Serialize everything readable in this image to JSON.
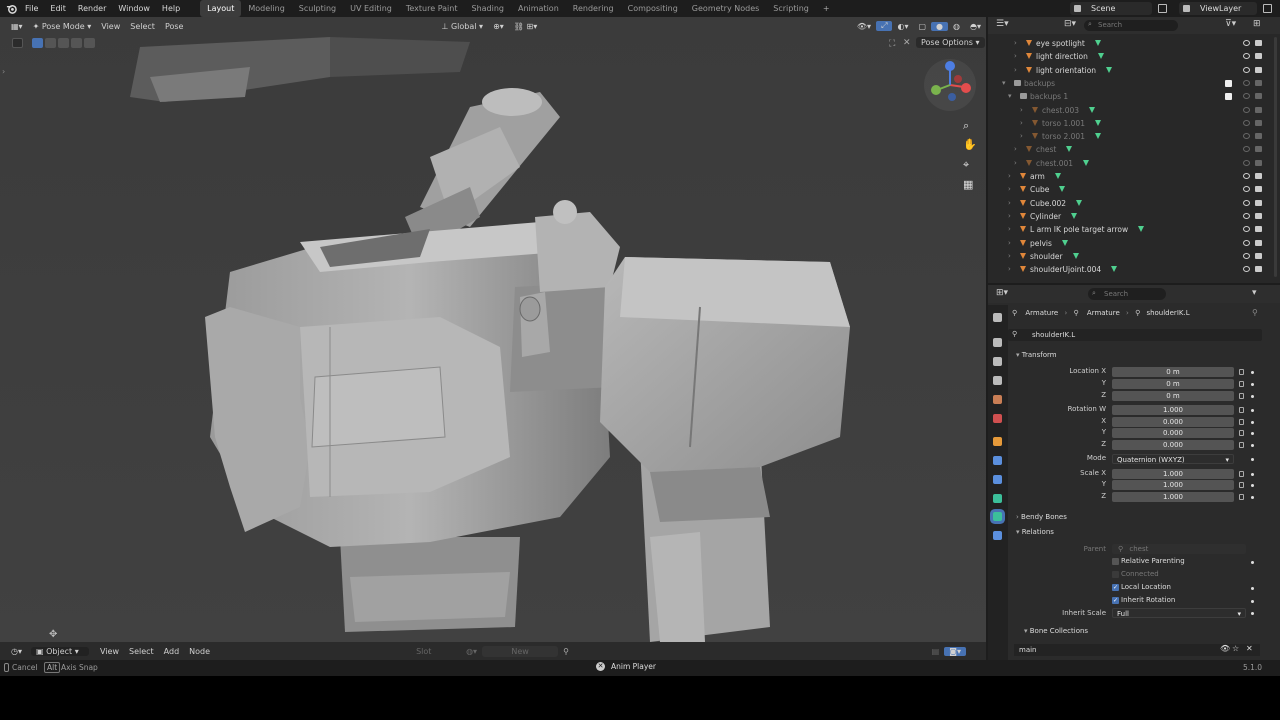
{
  "menu": [
    "File",
    "Edit",
    "Render",
    "Window",
    "Help"
  ],
  "workspaces": [
    "Layout",
    "Modeling",
    "Sculpting",
    "UV Editing",
    "Texture Paint",
    "Shading",
    "Animation",
    "Rendering",
    "Compositing",
    "Geometry Nodes",
    "Scripting"
  ],
  "active_workspace": "Layout",
  "scene": "Scene",
  "view_layer": "ViewLayer",
  "viewport": {
    "mode": "Pose Mode",
    "menus": [
      "View",
      "Select",
      "Pose"
    ],
    "transform_orientation": "Global",
    "pose_options": "Pose Options"
  },
  "outliner": {
    "search_placeholder": "Search",
    "rows": [
      {
        "label": "eye spotlight",
        "dim": false,
        "indent": 3
      },
      {
        "label": "light direction",
        "dim": false,
        "indent": 3
      },
      {
        "label": "light orientation",
        "dim": false,
        "indent": 3
      },
      {
        "label": "backups",
        "dim": true,
        "indent": 1
      },
      {
        "label": "backups 1",
        "dim": true,
        "indent": 2
      },
      {
        "label": "chest.003",
        "dim": true,
        "indent": 4
      },
      {
        "label": "torso 1.001",
        "dim": true,
        "indent": 4
      },
      {
        "label": "torso 2.001",
        "dim": true,
        "indent": 4
      },
      {
        "label": "chest",
        "dim": true,
        "indent": 3
      },
      {
        "label": "chest.001",
        "dim": true,
        "indent": 3
      },
      {
        "label": "arm",
        "dim": false,
        "indent": 2
      },
      {
        "label": "Cube",
        "dim": false,
        "indent": 2
      },
      {
        "label": "Cube.002",
        "dim": false,
        "indent": 2
      },
      {
        "label": "Cylinder",
        "dim": false,
        "indent": 2
      },
      {
        "label": "L arm IK pole target arrow",
        "dim": false,
        "indent": 2
      },
      {
        "label": "pelvis",
        "dim": false,
        "indent": 2
      },
      {
        "label": "shoulder",
        "dim": false,
        "indent": 2
      },
      {
        "label": "shoulderUjoint.004",
        "dim": false,
        "indent": 2
      }
    ]
  },
  "properties": {
    "search_placeholder": "Search",
    "breadcrumb": [
      "Armature",
      "Armature",
      "shoulderIK.L"
    ],
    "bone_name": "shoulderIK.L",
    "transform": {
      "title": "Transform",
      "location_label": "Location X",
      "location": [
        "0 m",
        "0 m",
        "0 m"
      ],
      "rotation_label": "Rotation W",
      "rotation": [
        "1.000",
        "0.000",
        "0.000",
        "0.000"
      ],
      "mode_label": "Mode",
      "mode": "Quaternion (WXYZ)",
      "scale_label": "Scale X",
      "scale": [
        "1.000",
        "1.000",
        "1.000"
      ],
      "axis_y": "Y",
      "axis_z": "Z",
      "axis_x": "X"
    },
    "bendy_bones": "Bendy Bones",
    "relations": {
      "title": "Relations",
      "parent_label": "Parent",
      "parent": "chest",
      "relative_parenting": "Relative Parenting",
      "connected": "Connected",
      "local_location": "Local Location",
      "inherit_rotation": "Inherit Rotation",
      "inherit_scale_label": "Inherit Scale",
      "inherit_scale": "Full"
    },
    "bone_collections": {
      "title": "Bone Collections",
      "item": "main"
    }
  },
  "bottom_editor": {
    "mode": "Object",
    "menus": [
      "View",
      "Select",
      "Add",
      "Node"
    ],
    "slot": "Slot",
    "new_button": "New"
  },
  "statusbar": {
    "cancel": "Cancel",
    "alt_key": "Alt",
    "axis_snap": "Axis Snap",
    "anim_player": "Anim Player",
    "version": "5.1.0"
  }
}
